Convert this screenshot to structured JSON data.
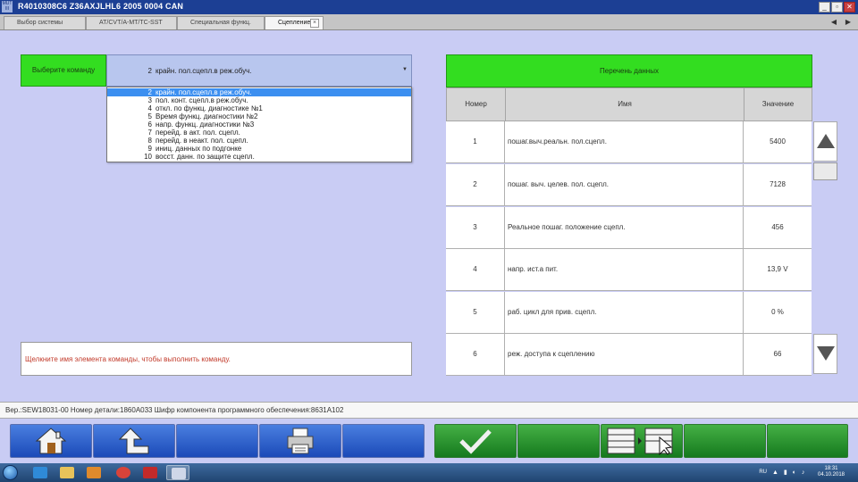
{
  "window": {
    "title": "R4010308C6   Z36AXJLHL6 2005    0004 CAN",
    "app_icon_text": "MUT III",
    "controls": [
      "minimize",
      "restore",
      "close"
    ]
  },
  "tabs": [
    {
      "label": "Выбор системы",
      "active": false
    },
    {
      "label": "AT/CVT/A-MT/TC-SST",
      "active": false
    },
    {
      "label": "Специальная функц.",
      "active": false
    },
    {
      "label": "Сцепление",
      "active": true
    }
  ],
  "command": {
    "label": "Выберите команду",
    "selected_number": "2",
    "selected_text": "крайн. пол.сцепл.в реж.обуч.",
    "options": [
      {
        "num": "2",
        "text": "крайн. пол.сцепл.в реж.обуч.",
        "selected": true
      },
      {
        "num": "3",
        "text": "пол. конт. сцепл.в реж.обуч.",
        "selected": false
      },
      {
        "num": "4",
        "text": "откл.  по функц.  диагностике №1",
        "selected": false
      },
      {
        "num": "5",
        "text": "Время функц.  диагностики №2",
        "selected": false
      },
      {
        "num": "6",
        "text": "напр. функц.  диагностики №3",
        "selected": false
      },
      {
        "num": "7",
        "text": "перейд. в акт.  пол. сцепл.",
        "selected": false
      },
      {
        "num": "8",
        "text": "перейд. в неакт. пол. сцепл.",
        "selected": false
      },
      {
        "num": "9",
        "text": "иниц. данных по подгонке",
        "selected": false
      },
      {
        "num": "10",
        "text": "восст. данн. по защите сцепл.",
        "selected": false
      }
    ],
    "hint": "Щелкните имя элемента команды, чтобы выполнить команду."
  },
  "data_list": {
    "title": "Перечень данных",
    "columns": {
      "num": "Номер",
      "name": "Имя",
      "value": "Значение"
    },
    "rows": [
      {
        "num": "1",
        "name": "пошаг.выч.реальн. пол.сцепл.",
        "value": "5400"
      },
      {
        "num": "2",
        "name": "пошаг. выч. целев. пол. сцепл.",
        "value": "7128"
      },
      {
        "num": "3",
        "name": "Реальное пошаг. положение сцепл.",
        "value": "456"
      },
      {
        "num": "4",
        "name": "напр. ист.а пит.",
        "value": "13,9 V"
      },
      {
        "num": "5",
        "name": "раб. цикл для прив. сцепл.",
        "value": "0 %"
      },
      {
        "num": "6",
        "name": "реж. доступа к сцеплению",
        "value": "66"
      }
    ]
  },
  "version_bar": "Вер.:SEW18031-00 Номер детали:1860A033   Шифр компонента программного обеспечения:8631A102",
  "toolbar": {
    "buttons": [
      "home-icon",
      "back-icon",
      "empty",
      "print-icon",
      "empty",
      "check-icon",
      "empty",
      "list-select-icon",
      "empty",
      "empty"
    ]
  },
  "taskbar": {
    "language": "RU",
    "time": "18:31",
    "date": "04.10.2018",
    "tray_icons": "▲ ▮ ◐ ♪"
  },
  "colors": {
    "background": "#c9ccf4",
    "header_green": "#33dd20",
    "toolbar_blue": "#1b4ab8",
    "toolbar_green": "#157a1e",
    "hint_red": "#c23a2a",
    "selection_blue": "#3c8ff0"
  }
}
